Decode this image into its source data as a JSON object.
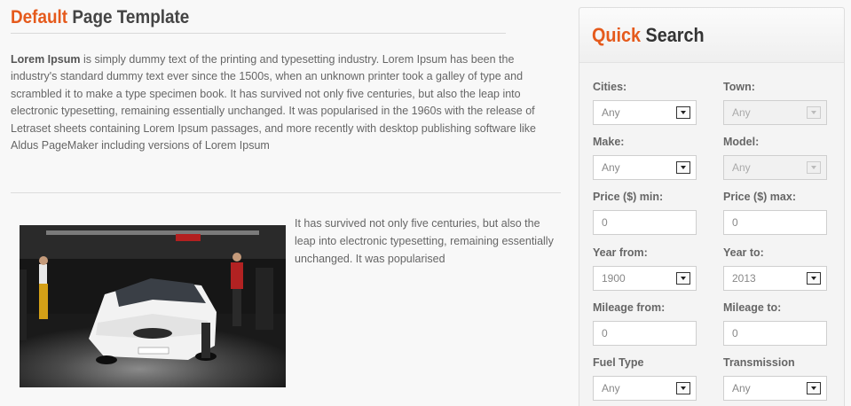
{
  "page": {
    "title_accent": "Default",
    "title_rest": "Page Template",
    "intro_bold": "Lorem Ipsum",
    "intro_text": " is simply dummy text of the printing and typesetting industry. Lorem Ipsum has been the industry's standard dummy text ever since the 1500s, when an unknown printer took a galley of type and scrambled it to make a type specimen book. It has survived not only five centuries, but also the leap into electronic typesetting, remaining essentially unchanged. It was popularised in the 1960s with the release of Letraset sheets containing Lorem Ipsum passages, and more recently with desktop publishing software like Aldus PageMaker including versions of Lorem Ipsum",
    "side_text": "It has survived not only five centuries, but also the leap into electronic typesetting, remaining essentially unchanged. It was popularised"
  },
  "search": {
    "title_accent": "Quick",
    "title_rest": "Search",
    "cities_label": "Cities:",
    "cities_value": "Any",
    "town_label": "Town:",
    "town_value": "Any",
    "make_label": "Make:",
    "make_value": "Any",
    "model_label": "Model:",
    "model_value": "Any",
    "price_min_label": "Price ($) min:",
    "price_min_value": "0",
    "price_max_label": "Price ($) max:",
    "price_max_value": "0",
    "year_from_label": "Year from:",
    "year_from_value": "1900",
    "year_to_label": "Year to:",
    "year_to_value": "2013",
    "mileage_from_label": "Mileage from:",
    "mileage_from_value": "0",
    "mileage_to_label": "Mileage to:",
    "mileage_to_value": "0",
    "fuel_label": "Fuel Type",
    "fuel_value": "Any",
    "transmission_label": "Transmission",
    "transmission_value": "Any"
  },
  "colors": {
    "accent": "#e55a1c"
  }
}
